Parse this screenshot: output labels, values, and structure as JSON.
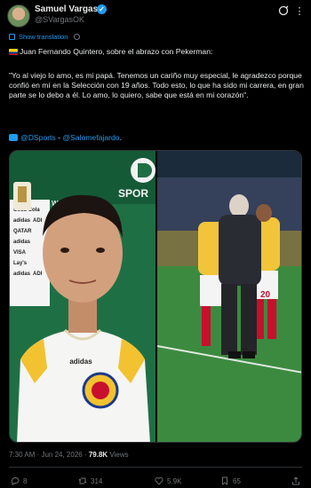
{
  "author": {
    "name": "Samuel Vargas",
    "handle": "@SVargasOK"
  },
  "translation": {
    "label": "Show translation"
  },
  "tweet": {
    "line1": "Juan Fernando Quintero, sobre el abrazo con Pekerman:",
    "quote": "\"Yo al viejo lo amo, es mi papá. Tenemos un cariño muy especial, le agradezco porque confió en mí en la Selección con 19 años. Todo esto, lo que ha sido mi carrera, en gran parte se lo debo a él. Lo amo, lo quiero, sabe que está en mi corazón\".",
    "mention1": "@DSports",
    "separator": " - ",
    "mention2": "@Salomefajardo",
    "end": "."
  },
  "media": {
    "left_logo_text": "SPOR",
    "left_sponsor": "WO",
    "shirt_brand": "adidas",
    "sponsor_wall": [
      "Coca-Cola",
      "adidas",
      "ADI",
      "QATAR",
      "adidas",
      "VISA",
      "Lay's",
      "adidas",
      "ADI"
    ]
  },
  "meta": {
    "time": "7:30 AM",
    "sep": " · ",
    "date": "Jun 24, 2026",
    "views_count": "79.8K",
    "views_label": " Views"
  },
  "actions": {
    "replies": "8",
    "reposts": "314",
    "likes": "5.9K",
    "bookmarks": "65"
  },
  "colors": {
    "accent": "#1d9bf0",
    "background": "#000000",
    "muted": "#71767b"
  },
  "icons": [
    "verified-badge-icon",
    "grok-icon",
    "more-icon",
    "translate-icon",
    "settings-icon",
    "reply-icon",
    "repost-icon",
    "like-icon",
    "bookmark-icon",
    "share-icon"
  ]
}
